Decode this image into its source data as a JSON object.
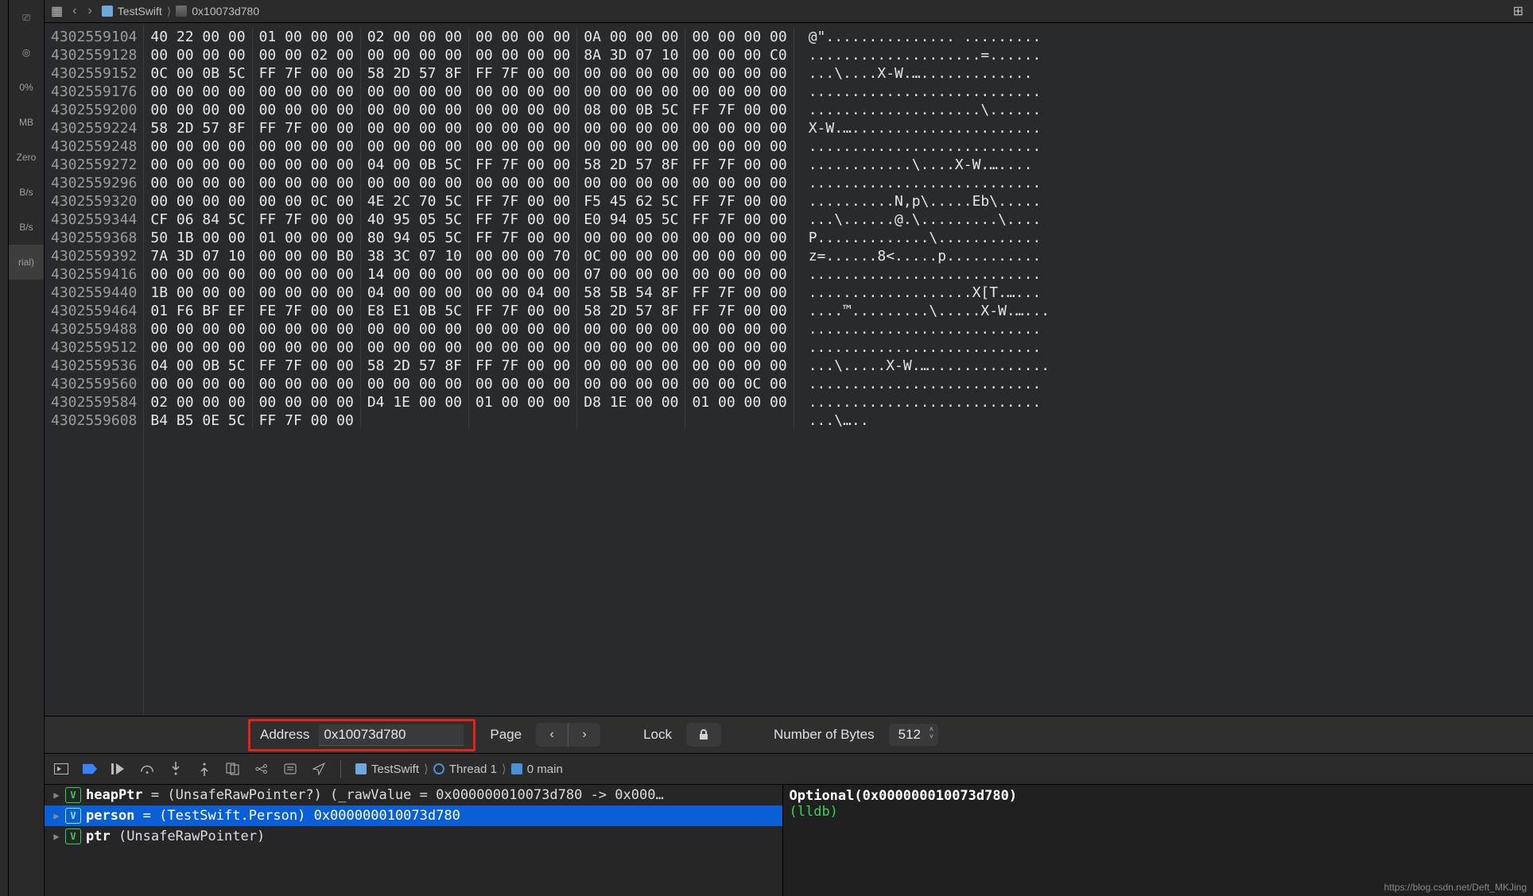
{
  "leftRail": [
    "⎚",
    "◎",
    "0%",
    "MB",
    "Zero",
    "B/s",
    "B/s",
    "rial)"
  ],
  "breadcrumb": {
    "back": "‹",
    "fwd": "›",
    "sep": "⟩",
    "proj": "TestSwift",
    "addr": "0x10073d780"
  },
  "hex": {
    "addresses": [
      "4302559104",
      "4302559128",
      "4302559152",
      "4302559176",
      "4302559200",
      "4302559224",
      "4302559248",
      "4302559272",
      "4302559296",
      "4302559320",
      "4302559344",
      "4302559368",
      "4302559392",
      "4302559416",
      "4302559440",
      "4302559464",
      "4302559488",
      "4302559512",
      "4302559536",
      "4302559560",
      "4302559584",
      "4302559608"
    ],
    "rows": [
      [
        "40 22 00 00",
        "01 00 00 00",
        "02 00 00 00",
        "00 00 00 00",
        "0A 00 00 00",
        "00 00 00 00"
      ],
      [
        "00 00 00 00",
        "00 00 02 00",
        "00 00 00 00",
        "00 00 00 00",
        "8A 3D 07 10",
        "00 00 00 C0"
      ],
      [
        "0C 00 0B 5C",
        "FF 7F 00 00",
        "58 2D 57 8F",
        "FF 7F 00 00",
        "00 00 00 00",
        "00 00 00 00"
      ],
      [
        "00 00 00 00",
        "00 00 00 00",
        "00 00 00 00",
        "00 00 00 00",
        "00 00 00 00",
        "00 00 00 00"
      ],
      [
        "00 00 00 00",
        "00 00 00 00",
        "00 00 00 00",
        "00 00 00 00",
        "08 00 0B 5C",
        "FF 7F 00 00"
      ],
      [
        "58 2D 57 8F",
        "FF 7F 00 00",
        "00 00 00 00",
        "00 00 00 00",
        "00 00 00 00",
        "00 00 00 00"
      ],
      [
        "00 00 00 00",
        "00 00 00 00",
        "00 00 00 00",
        "00 00 00 00",
        "00 00 00 00",
        "00 00 00 00"
      ],
      [
        "00 00 00 00",
        "00 00 00 00",
        "04 00 0B 5C",
        "FF 7F 00 00",
        "58 2D 57 8F",
        "FF 7F 00 00"
      ],
      [
        "00 00 00 00",
        "00 00 00 00",
        "00 00 00 00",
        "00 00 00 00",
        "00 00 00 00",
        "00 00 00 00"
      ],
      [
        "00 00 00 00",
        "00 00 0C 00",
        "4E 2C 70 5C",
        "FF 7F 00 00",
        "F5 45 62 5C",
        "FF 7F 00 00"
      ],
      [
        "CF 06 84 5C",
        "FF 7F 00 00",
        "40 95 05 5C",
        "FF 7F 00 00",
        "E0 94 05 5C",
        "FF 7F 00 00"
      ],
      [
        "50 1B 00 00",
        "01 00 00 00",
        "80 94 05 5C",
        "FF 7F 00 00",
        "00 00 00 00",
        "00 00 00 00"
      ],
      [
        "7A 3D 07 10",
        "00 00 00 B0",
        "38 3C 07 10",
        "00 00 00 70",
        "0C 00 00 00",
        "00 00 00 00"
      ],
      [
        "00 00 00 00",
        "00 00 00 00",
        "14 00 00 00",
        "00 00 00 00",
        "07 00 00 00",
        "00 00 00 00"
      ],
      [
        "1B 00 00 00",
        "00 00 00 00",
        "04 00 00 00",
        "00 00 04 00",
        "58 5B 54 8F",
        "FF 7F 00 00"
      ],
      [
        "01 F6 BF EF",
        "FE 7F 00 00",
        "E8 E1 0B 5C",
        "FF 7F 00 00",
        "58 2D 57 8F",
        "FF 7F 00 00"
      ],
      [
        "00 00 00 00",
        "00 00 00 00",
        "00 00 00 00",
        "00 00 00 00",
        "00 00 00 00",
        "00 00 00 00"
      ],
      [
        "00 00 00 00",
        "00 00 00 00",
        "00 00 00 00",
        "00 00 00 00",
        "00 00 00 00",
        "00 00 00 00"
      ],
      [
        "04 00 0B 5C",
        "FF 7F 00 00",
        "58 2D 57 8F",
        "FF 7F 00 00",
        "00 00 00 00",
        "00 00 00 00"
      ],
      [
        "00 00 00 00",
        "00 00 00 00",
        "00 00 00 00",
        "00 00 00 00",
        "00 00 00 00",
        "00 00 0C 00"
      ],
      [
        "02 00 00 00",
        "00 00 00 00",
        "D4 1E 00 00",
        "01 00 00 00",
        "D8 1E 00 00",
        "01 00 00 00"
      ],
      [
        "B4 B5 0E 5C",
        "FF 7F 00 00",
        "",
        "",
        "",
        ""
      ]
    ],
    "ascii": [
      "@\"............... .........",
      "....................=......",
      "...\\....X-W.….............",
      "...........................",
      "....................\\......",
      "X-W.…......................",
      "...........................",
      "............\\....X-W.…....",
      "...........................",
      "..........N,p\\.....Eb\\.....",
      "...\\......@.\\.........\\....",
      "P.............\\............",
      "z=......8<.....p...........",
      "...........................",
      "...................X[T.…...",
      "....™.........\\.....X-W.…...",
      "...........................",
      "...........................",
      "...\\.....X-W.…..............",
      "...........................",
      "...........................",
      "...\\….."
    ]
  },
  "addrbar": {
    "label": "Address",
    "value": "0x10073d780",
    "page": "Page",
    "lock": "Lock",
    "bytesLabel": "Number of Bytes",
    "bytesValue": "512"
  },
  "debugBar": {
    "proj": "TestSwift",
    "thread": "Thread 1",
    "frame": "0 main"
  },
  "vars": [
    {
      "name": "heapPtr",
      "rest": " = (UnsafeRawPointer?) (_rawValue = 0x000000010073d780 -> 0x000…",
      "sel": false
    },
    {
      "name": "person",
      "rest": " = (TestSwift.Person) 0x000000010073d780",
      "sel": true
    },
    {
      "name": "ptr",
      "rest": " (UnsafeRawPointer)",
      "sel": false
    }
  ],
  "console": {
    "line1": "Optional(0x000000010073d780)",
    "prompt": "(lldb) "
  },
  "watermark": "https://blog.csdn.net/Deft_MKJing"
}
